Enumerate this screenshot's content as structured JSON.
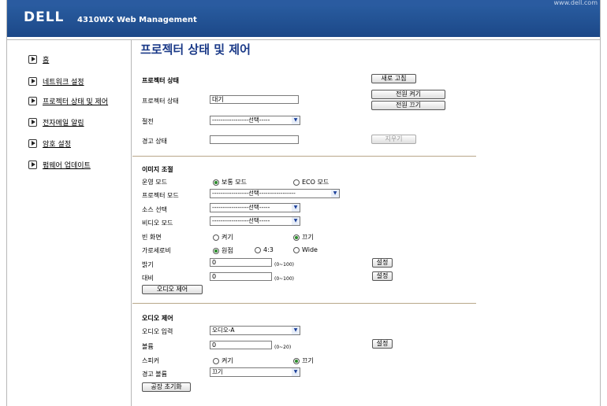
{
  "header": {
    "site": "www.dell.com",
    "logo": "DELL",
    "title": "4310WX Web Management"
  },
  "sidebar": {
    "items": [
      {
        "label": "홈"
      },
      {
        "label": "네트워크 설정"
      },
      {
        "label": "프로젝터 상태 및 제어"
      },
      {
        "label": "전자메일 알림"
      },
      {
        "label": "암호 설정"
      },
      {
        "label": "펌웨어 업데이트"
      }
    ]
  },
  "main": {
    "title": "프로젝터 상태 및 제어",
    "status": {
      "heading": "프로젝터 상태",
      "refresh": "새로 고침",
      "power_on": "전원 켜기",
      "power_off": "전원 끄기",
      "state_label": "프로젝터 상태",
      "state_value": "대기",
      "saving_label": "절전",
      "saving_value": "-----------------선택-----",
      "warn_label": "경고 상태",
      "warn_value": "",
      "clear": "지우기"
    },
    "image": {
      "heading": "이미지 조절",
      "op_label": "운영 모드",
      "op_opts": [
        "보통 모드",
        "ECO 모드"
      ],
      "proj_label": "프로젝터 모드",
      "proj_value": "-----------------선택-----------------",
      "src_label": "소스 선택",
      "src_value": "-----------------선택-----",
      "vid_label": "비디오 모드",
      "vid_value": "-----------------선택-----",
      "blank_label": "빈 화면",
      "blank_opts": [
        "켜기",
        "끄기"
      ],
      "aspect_label": "가로세로비",
      "aspect_opts": [
        "원점",
        "4:3",
        "Wide"
      ],
      "bright_label": "밝기",
      "bright_value": "0",
      "bright_range": "(0~100)",
      "contrast_label": "대비",
      "contrast_value": "0",
      "contrast_range": "(0~100)",
      "set": "설정",
      "audio_btn": "오디오 제어"
    },
    "audio": {
      "heading": "오디오 제어",
      "input_label": "오디오 입력",
      "input_value": "오디오-A",
      "vol_label": "볼륨",
      "vol_value": "0",
      "vol_range": "(0~20)",
      "set": "설정",
      "spk_label": "스피커",
      "spk_opts": [
        "켜기",
        "끄기"
      ],
      "alarm_label": "경고 볼륨",
      "alarm_value": "끄기",
      "reset": "공장 초기화"
    }
  },
  "colors": {
    "banner": "#1c4888",
    "title": "#1b3a88"
  }
}
